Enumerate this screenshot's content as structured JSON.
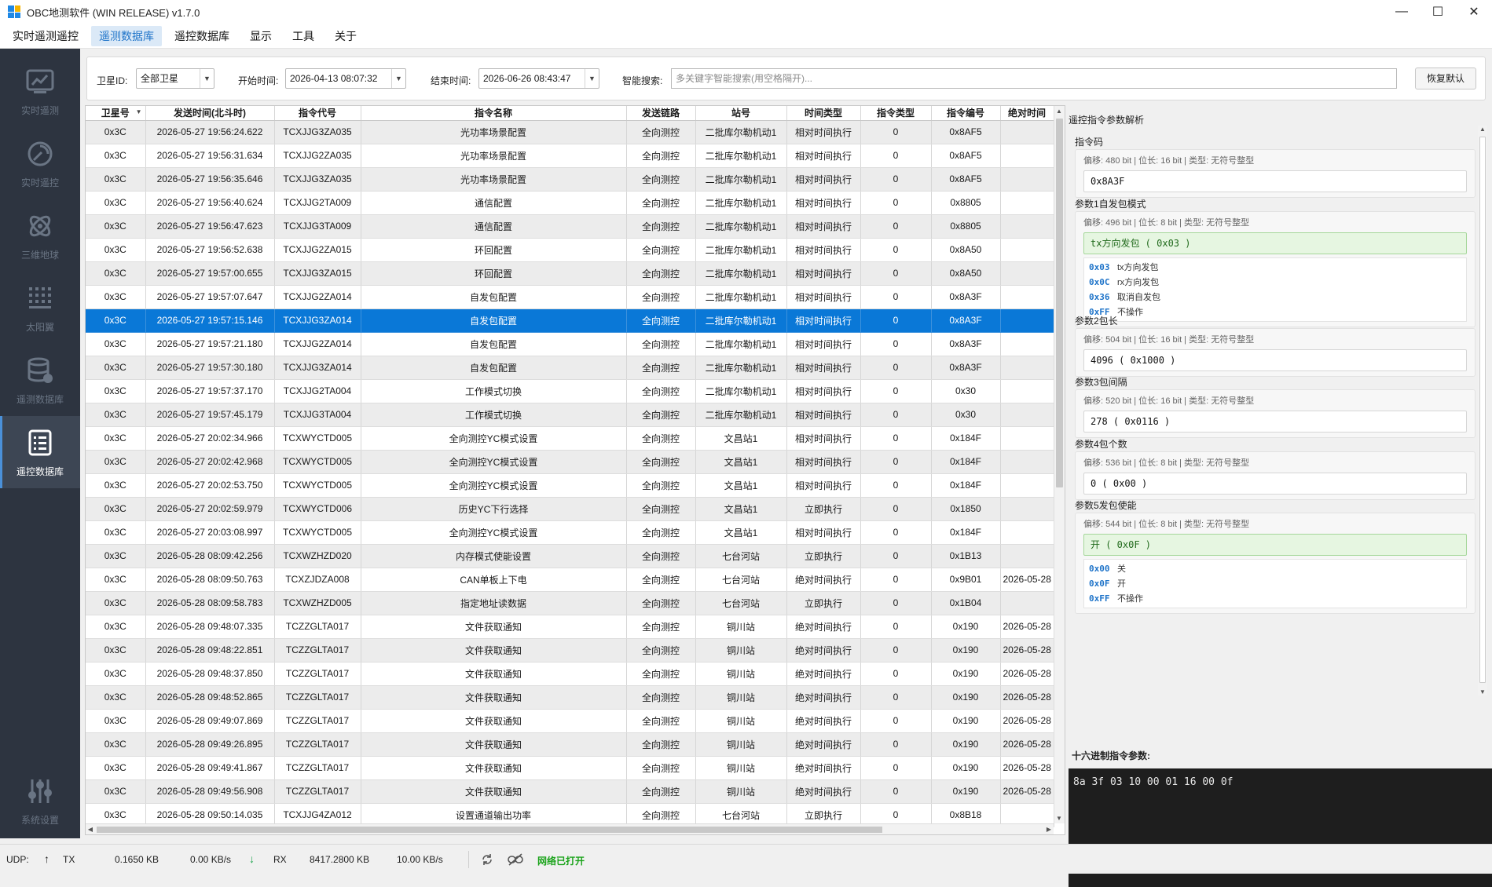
{
  "window": {
    "title": "OBC地测软件 (WIN RELEASE) v1.7.0",
    "min": "—",
    "max": "☐",
    "close": "✕"
  },
  "menu": [
    "实时遥测遥控",
    "遥测数据库",
    "遥控数据库",
    "显示",
    "工具",
    "关于"
  ],
  "menu_active_index": 1,
  "sidebar": [
    {
      "label": "实时遥测",
      "icon": "chart-icon"
    },
    {
      "label": "实时遥控",
      "icon": "satellite-dish-icon"
    },
    {
      "label": "三维地球",
      "icon": "orbit-icon"
    },
    {
      "label": "太阳翼",
      "icon": "solar-panel-icon"
    },
    {
      "label": "遥测数据库",
      "icon": "database-icon"
    },
    {
      "label": "遥控数据库",
      "icon": "document-list-icon"
    },
    {
      "label": "系统设置",
      "icon": "sliders-icon"
    }
  ],
  "sidebar_active_index": 5,
  "filter": {
    "sat_label": "卫星ID:",
    "sat_value": "全部卫星",
    "start_label": "开始时间:",
    "start_value": "2026-04-13 08:07:32",
    "end_label": "结束时间:",
    "end_value": "2026-06-26 08:43:47",
    "search_label": "智能搜索:",
    "search_placeholder": "多关键字智能搜索(用空格隔开)...",
    "reset_button": "恢复默认"
  },
  "table": {
    "columns": [
      "卫星号",
      "发送时间(北斗时)",
      "指令代号",
      "指令名称",
      "发送链路",
      "站号",
      "时间类型",
      "指令类型",
      "指令编号",
      "绝对时间"
    ],
    "rows": [
      [
        "0x3C",
        "2026-05-27 19:56:24.622",
        "TCXJJG3ZA035",
        "光功率场景配置",
        "全向测控",
        "二批库尔勒机动1",
        "相对时间执行",
        "0",
        "0x8AF5",
        ""
      ],
      [
        "0x3C",
        "2026-05-27 19:56:31.634",
        "TCXJJG2ZA035",
        "光功率场景配置",
        "全向测控",
        "二批库尔勒机动1",
        "相对时间执行",
        "0",
        "0x8AF5",
        ""
      ],
      [
        "0x3C",
        "2026-05-27 19:56:35.646",
        "TCXJJG3ZA035",
        "光功率场景配置",
        "全向测控",
        "二批库尔勒机动1",
        "相对时间执行",
        "0",
        "0x8AF5",
        ""
      ],
      [
        "0x3C",
        "2026-05-27 19:56:40.624",
        "TCXJJG2TA009",
        "通信配置",
        "全向测控",
        "二批库尔勒机动1",
        "相对时间执行",
        "0",
        "0x8805",
        ""
      ],
      [
        "0x3C",
        "2026-05-27 19:56:47.623",
        "TCXJJG3TA009",
        "通信配置",
        "全向测控",
        "二批库尔勒机动1",
        "相对时间执行",
        "0",
        "0x8805",
        ""
      ],
      [
        "0x3C",
        "2026-05-27 19:56:52.638",
        "TCXJJG2ZA015",
        "环回配置",
        "全向测控",
        "二批库尔勒机动1",
        "相对时间执行",
        "0",
        "0x8A50",
        ""
      ],
      [
        "0x3C",
        "2026-05-27 19:57:00.655",
        "TCXJJG3ZA015",
        "环回配置",
        "全向测控",
        "二批库尔勒机动1",
        "相对时间执行",
        "0",
        "0x8A50",
        ""
      ],
      [
        "0x3C",
        "2026-05-27 19:57:07.647",
        "TCXJJG2ZA014",
        "自发包配置",
        "全向测控",
        "二批库尔勒机动1",
        "相对时间执行",
        "0",
        "0x8A3F",
        ""
      ],
      [
        "0x3C",
        "2026-05-27 19:57:15.146",
        "TCXJJG3ZA014",
        "自发包配置",
        "全向测控",
        "二批库尔勒机动1",
        "相对时间执行",
        "0",
        "0x8A3F",
        ""
      ],
      [
        "0x3C",
        "2026-05-27 19:57:21.180",
        "TCXJJG2ZA014",
        "自发包配置",
        "全向测控",
        "二批库尔勒机动1",
        "相对时间执行",
        "0",
        "0x8A3F",
        ""
      ],
      [
        "0x3C",
        "2026-05-27 19:57:30.180",
        "TCXJJG3ZA014",
        "自发包配置",
        "全向测控",
        "二批库尔勒机动1",
        "相对时间执行",
        "0",
        "0x8A3F",
        ""
      ],
      [
        "0x3C",
        "2026-05-27 19:57:37.170",
        "TCXJJG2TA004",
        "工作模式切换",
        "全向测控",
        "二批库尔勒机动1",
        "相对时间执行",
        "0",
        "0x30",
        ""
      ],
      [
        "0x3C",
        "2026-05-27 19:57:45.179",
        "TCXJJG3TA004",
        "工作模式切换",
        "全向测控",
        "二批库尔勒机动1",
        "相对时间执行",
        "0",
        "0x30",
        ""
      ],
      [
        "0x3C",
        "2026-05-27 20:02:34.966",
        "TCXWYCTD005",
        "全向测控YC模式设置",
        "全向测控",
        "文昌站1",
        "相对时间执行",
        "0",
        "0x184F",
        ""
      ],
      [
        "0x3C",
        "2026-05-27 20:02:42.968",
        "TCXWYCTD005",
        "全向测控YC模式设置",
        "全向测控",
        "文昌站1",
        "相对时间执行",
        "0",
        "0x184F",
        ""
      ],
      [
        "0x3C",
        "2026-05-27 20:02:53.750",
        "TCXWYCTD005",
        "全向测控YC模式设置",
        "全向测控",
        "文昌站1",
        "相对时间执行",
        "0",
        "0x184F",
        ""
      ],
      [
        "0x3C",
        "2026-05-27 20:02:59.979",
        "TCXWYCTD006",
        "历史YC下行选择",
        "全向测控",
        "文昌站1",
        "立即执行",
        "0",
        "0x1850",
        ""
      ],
      [
        "0x3C",
        "2026-05-27 20:03:08.997",
        "TCXWYCTD005",
        "全向测控YC模式设置",
        "全向测控",
        "文昌站1",
        "相对时间执行",
        "0",
        "0x184F",
        ""
      ],
      [
        "0x3C",
        "2026-05-28 08:09:42.256",
        "TCXWZHZD020",
        "内存模式使能设置",
        "全向测控",
        "七台河站",
        "立即执行",
        "0",
        "0x1B13",
        ""
      ],
      [
        "0x3C",
        "2026-05-28 08:09:50.763",
        "TCXZJDZA008",
        "CAN单板上下电",
        "全向测控",
        "七台河站",
        "绝对时间执行",
        "0",
        "0x9B01",
        "2026-05-28"
      ],
      [
        "0x3C",
        "2026-05-28 08:09:58.783",
        "TCXWZHZD005",
        "指定地址读数据",
        "全向测控",
        "七台河站",
        "立即执行",
        "0",
        "0x1B04",
        ""
      ],
      [
        "0x3C",
        "2026-05-28 09:48:07.335",
        "TCZZGLTA017",
        "文件获取通知",
        "全向测控",
        "铜川站",
        "绝对时间执行",
        "0",
        "0x190",
        "2026-05-28"
      ],
      [
        "0x3C",
        "2026-05-28 09:48:22.851",
        "TCZZGLTA017",
        "文件获取通知",
        "全向测控",
        "铜川站",
        "绝对时间执行",
        "0",
        "0x190",
        "2026-05-28"
      ],
      [
        "0x3C",
        "2026-05-28 09:48:37.850",
        "TCZZGLTA017",
        "文件获取通知",
        "全向测控",
        "铜川站",
        "绝对时间执行",
        "0",
        "0x190",
        "2026-05-28"
      ],
      [
        "0x3C",
        "2026-05-28 09:48:52.865",
        "TCZZGLTA017",
        "文件获取通知",
        "全向测控",
        "铜川站",
        "绝对时间执行",
        "0",
        "0x190",
        "2026-05-28"
      ],
      [
        "0x3C",
        "2026-05-28 09:49:07.869",
        "TCZZGLTA017",
        "文件获取通知",
        "全向测控",
        "铜川站",
        "绝对时间执行",
        "0",
        "0x190",
        "2026-05-28"
      ],
      [
        "0x3C",
        "2026-05-28 09:49:26.895",
        "TCZZGLTA017",
        "文件获取通知",
        "全向测控",
        "铜川站",
        "绝对时间执行",
        "0",
        "0x190",
        "2026-05-28"
      ],
      [
        "0x3C",
        "2026-05-28 09:49:41.867",
        "TCZZGLTA017",
        "文件获取通知",
        "全向测控",
        "铜川站",
        "绝对时间执行",
        "0",
        "0x190",
        "2026-05-28"
      ],
      [
        "0x3C",
        "2026-05-28 09:49:56.908",
        "TCZZGLTA017",
        "文件获取通知",
        "全向测控",
        "铜川站",
        "绝对时间执行",
        "0",
        "0x190",
        "2026-05-28"
      ],
      [
        "0x3C",
        "2026-05-28 09:50:14.035",
        "TCXJJG4ZA012",
        "设置通道输出功率",
        "全向测控",
        "七台河站",
        "立即执行",
        "0",
        "0x8B18",
        ""
      ]
    ],
    "selected_row": 8
  },
  "params": {
    "panel_title": "遥控指令参数解析",
    "groups": [
      {
        "label": "指令码",
        "meta": "偏移: 480 bit | 位长: 16 bit | 类型: 无符号整型",
        "value": "0x8A3F",
        "highlight": false,
        "options": []
      },
      {
        "label": "参数1自发包模式",
        "meta": "偏移: 496 bit | 位长: 8 bit | 类型: 无符号整型",
        "value": "tx方向发包 ( 0x03 )",
        "highlight": true,
        "options": [
          {
            "code": "0x03",
            "text": "tx方向发包"
          },
          {
            "code": "0x0C",
            "text": "rx方向发包"
          },
          {
            "code": "0x36",
            "text": "取消自发包"
          },
          {
            "code": "0xFF",
            "text": "不操作"
          }
        ]
      },
      {
        "label": "参数2包长",
        "meta": "偏移: 504 bit | 位长: 16 bit | 类型: 无符号整型",
        "value": "4096 ( 0x1000 )",
        "highlight": false,
        "options": []
      },
      {
        "label": "参数3包间隔",
        "meta": "偏移: 520 bit | 位长: 16 bit | 类型: 无符号整型",
        "value": "278 ( 0x0116 )",
        "highlight": false,
        "options": []
      },
      {
        "label": "参数4包个数",
        "meta": "偏移: 536 bit | 位长: 8 bit | 类型: 无符号整型",
        "value": "0 ( 0x00 )",
        "highlight": false,
        "options": []
      },
      {
        "label": "参数5发包使能",
        "meta": "偏移: 544 bit | 位长: 8 bit | 类型: 无符号整型",
        "value": "开 ( 0x0F )",
        "highlight": true,
        "options": [
          {
            "code": "0x00",
            "text": "关"
          },
          {
            "code": "0x0F",
            "text": "开"
          },
          {
            "code": "0xFF",
            "text": "不操作"
          }
        ]
      }
    ],
    "hex_label": "十六进制指令参数:",
    "hex_value": "8a 3f 03 10 00 01 16 00 0f"
  },
  "status": {
    "udp_label": "UDP:",
    "tx_label": "TX",
    "tx_total": "0.1650 KB",
    "tx_rate": "0.00 KB/s",
    "rx_label": "RX",
    "rx_total": "8417.2800 KB",
    "rx_rate": "10.00 KB/s",
    "network_state": "网络已打开",
    "up_arrow": "↑",
    "down_arrow": "↓"
  },
  "colors": {
    "accent": "#0a78d7",
    "sidebar_bg": "#2d3440",
    "network_ok": "#1aa31a",
    "rx_arrow": "#19a34a"
  }
}
